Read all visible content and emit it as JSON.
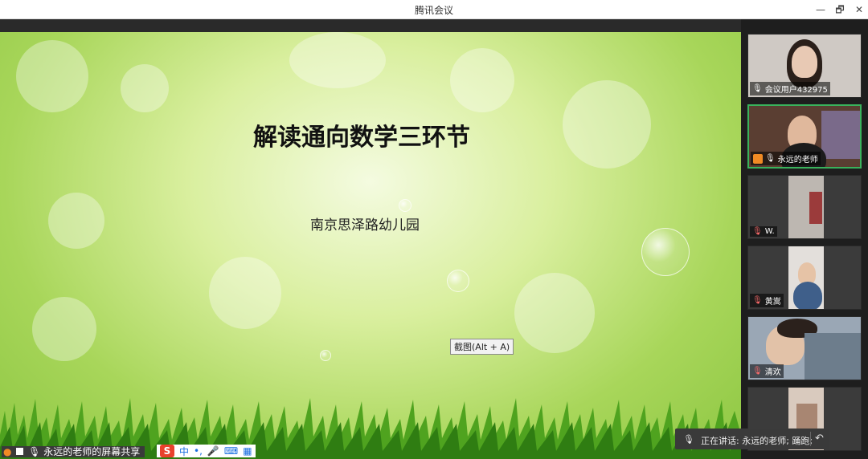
{
  "window": {
    "title": "腾讯会议",
    "minimize": "—",
    "restore": "🗗",
    "close": "✕"
  },
  "slide": {
    "title": "解读通向数学三环节",
    "subtitle": "南京思泽路幼儿园"
  },
  "tooltip": "截图(Alt + A)",
  "share_bar": {
    "label": "永远的老师的屏幕共享"
  },
  "ime": {
    "logo": "S",
    "mode": "中",
    "punct": "•,",
    "voice": "🎤",
    "keyboard": "⌨",
    "apps": "▦"
  },
  "participants": [
    {
      "name": "会议用户432975",
      "mic": "on",
      "active": false,
      "has_video": true,
      "bg": "#c9c4c0"
    },
    {
      "name": "永远的老师",
      "mic": "on",
      "active": true,
      "has_video": true,
      "host": true,
      "bg": "#6b4b3d"
    },
    {
      "name": "W.",
      "mic": "muted",
      "active": false,
      "has_video": true,
      "bg": "#b9b6b3"
    },
    {
      "name": "黄嵩",
      "mic": "muted",
      "active": false,
      "has_video": true,
      "bg": "#d3d0cc"
    },
    {
      "name": "清欢",
      "mic": "muted",
      "active": false,
      "has_video": true,
      "bg": "#9aa7b5"
    },
    {
      "name": "",
      "mic": "muted",
      "active": false,
      "has_video": true,
      "bg": "#d6c9bd"
    }
  ],
  "speaking": {
    "text": "正在讲话: 永远的老师; 踊跑;"
  },
  "colors": {
    "active_border": "#39b25c",
    "slide_green": "#a8d65a"
  }
}
